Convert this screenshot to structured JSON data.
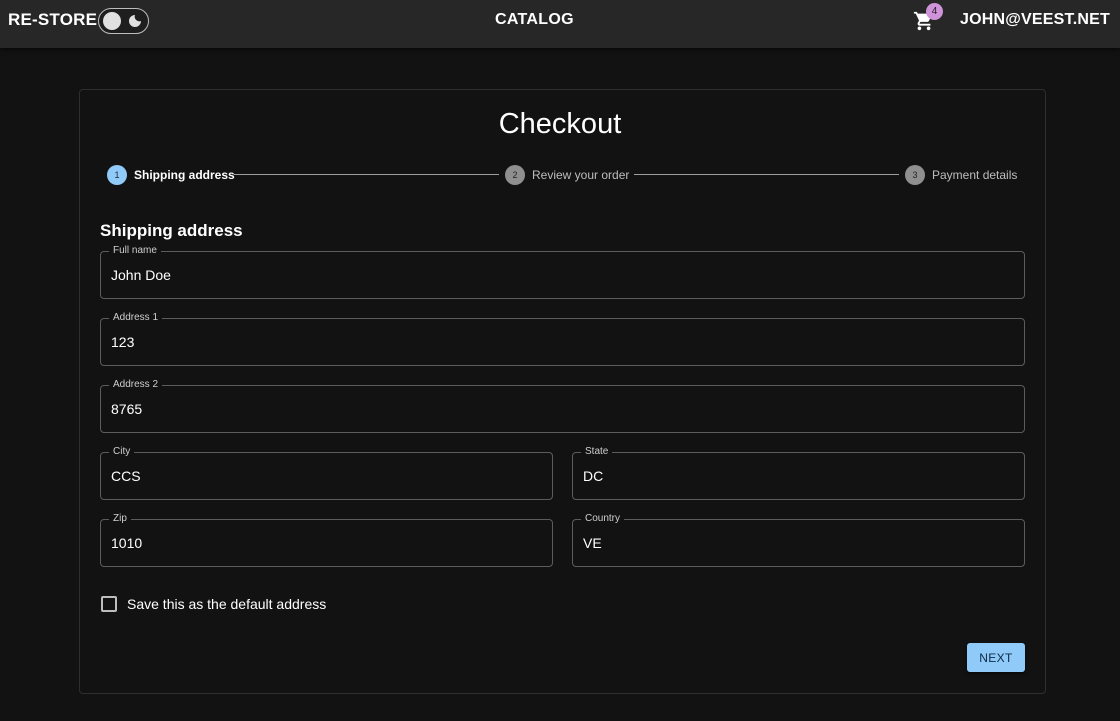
{
  "appbar": {
    "brand": "RE-STORE",
    "nav_catalog": "CATALOG",
    "cart_count": "4",
    "user_email": "JOHN@VEEST.NET",
    "theme_icon": "moon-icon",
    "cart_icon": "shopping-cart-icon"
  },
  "checkout": {
    "title": "Checkout",
    "steps": [
      {
        "number": "1",
        "label": "Shipping address",
        "active": true
      },
      {
        "number": "2",
        "label": "Review your order",
        "active": false
      },
      {
        "number": "3",
        "label": "Payment details",
        "active": false
      }
    ],
    "section_title": "Shipping address",
    "fields": {
      "full_name": {
        "label": "Full name",
        "value": "John Doe"
      },
      "address1": {
        "label": "Address 1",
        "value": "123"
      },
      "address2": {
        "label": "Address 2",
        "value": "8765"
      },
      "city": {
        "label": "City",
        "value": "CCS"
      },
      "state": {
        "label": "State",
        "value": "DC"
      },
      "zip": {
        "label": "Zip",
        "value": "1010"
      },
      "country": {
        "label": "Country",
        "value": "VE"
      }
    },
    "save_default_label": "Save this as the default address",
    "save_default_checked": false,
    "next_label": "NEXT"
  },
  "colors": {
    "background": "#121212",
    "appbar": "#272727",
    "primary": "#90caf9",
    "badge": "#ce93d8"
  }
}
